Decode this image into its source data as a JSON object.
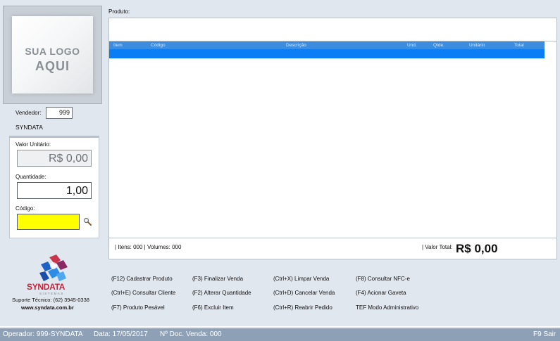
{
  "logo": {
    "line1": "SUA LOGO",
    "line2": "AQUI"
  },
  "vendor": {
    "label": "Vendedor:",
    "code": "999",
    "name": "SYNDATA"
  },
  "value_panel": {
    "unit_price_label": "Valor Unitário:",
    "unit_price_value": "R$ 0,00",
    "quantity_label": "Quantidade:",
    "quantity_value": "1,00",
    "code_label": "Código:",
    "code_value": "",
    "code_field_color": "#ffff00"
  },
  "product": {
    "label": "Produto:",
    "value": ""
  },
  "grid": {
    "columns": [
      "Item",
      "Código",
      "Descrição",
      "Und.",
      "Qtde.",
      "Unitário",
      "Total"
    ],
    "header_color": "#3c8de0",
    "selection_color": "#0b7df5"
  },
  "totals": {
    "items_volumes": "| Itens: 000 | Volumes: 000",
    "total_label": "| Valor Total:",
    "total_value": "R$ 0,00"
  },
  "brand": {
    "name": "SYNDATA",
    "subtitle": "SISTEMAS",
    "support": "Suporte Técnico: (62) 3945-0338",
    "website": "www.syndata.com.br"
  },
  "shortcuts": [
    [
      "(F12) Cadastrar Produto",
      "(Ctrl+E) Consultar Cliente",
      "(F7) Produto Pesável"
    ],
    [
      "(F3) Finalizar Venda",
      "(F2) Alterar Quantidade",
      "(F6) Excluir Item"
    ],
    [
      "(Ctrl+X) Limpar Venda",
      "(Ctrl+D) Cancelar Venda",
      "(Ctrl+R) Reabrir Pedido"
    ],
    [
      "(F8) Consultar NFC-e",
      "(F4) Acionar Gaveta",
      "TEF Modo Administrativo"
    ]
  ],
  "status_bar": {
    "operator": "Operador: 999-SYNDATA",
    "date": "Data: 17/05/2017",
    "doc": "Nº Doc. Venda: 000",
    "exit": "F9 Sair",
    "color": "#8ea0b5"
  }
}
